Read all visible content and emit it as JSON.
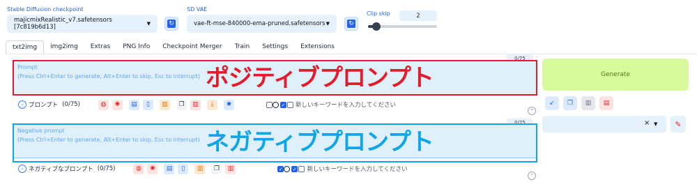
{
  "checkpoint": {
    "label": "Stable Diffusion checkpoint",
    "value": "majicmixRealistic_v7.safetensors [7c819b6d13]"
  },
  "vae": {
    "label": "SD VAE",
    "value": "vae-ft-mse-840000-ema-pruned.safetensors"
  },
  "clip_skip": {
    "label": "Clip skip",
    "value": "2",
    "level": 0.08
  },
  "tabs": [
    {
      "label": "txt2img"
    },
    {
      "label": "img2img"
    },
    {
      "label": "Extras"
    },
    {
      "label": "PNG Info"
    },
    {
      "label": "Checkpoint Merger"
    },
    {
      "label": "Train"
    },
    {
      "label": "Settings"
    },
    {
      "label": "Extensions"
    }
  ],
  "prompt": {
    "title": "Prompt",
    "hint": "(Press Ctrl+Enter to generate, Alt+Enter to skip, Esc to interrupt)",
    "overlay": "ポジティブプロンプト",
    "counter": "0/75",
    "toolbar_label": "プロンプト",
    "toolbar_count": "(0/75)",
    "keyword_placeholder": "新しいキーワードを入力してください"
  },
  "negative": {
    "title": "Negative prompt",
    "hint": "(Press Ctrl+Enter to generate, Alt+Enter to skip, Esc to interrupt)",
    "overlay": "ネガティブプロンプト",
    "counter": "0/75",
    "toolbar_label": "ネガティブなプロンプト",
    "toolbar_count": "(0/75)",
    "keyword_placeholder": "新しいキーワードを入力してください"
  },
  "generate_label": "Generate",
  "colors": {
    "positive_annotation": "#e11d2b",
    "negative_annotation": "#0ea5e9",
    "generate_bg": "#d9f99d"
  },
  "icons": {
    "toolbar_prompt": [
      "globe-icon",
      "gear-icon",
      "clipboard-icon",
      "bookmark-icon",
      "book-icon",
      "copy-icon",
      "trash-icon",
      "download-icon",
      "settings-icon"
    ],
    "toolbar_negative": [
      "globe-icon",
      "gear-icon",
      "clipboard-icon",
      "bookmark-icon",
      "book-icon",
      "copy-icon",
      "trash-icon"
    ],
    "side_buttons": [
      "arrow-icon",
      "copy-icon",
      "trash-icon",
      "clipboard-icon"
    ]
  }
}
